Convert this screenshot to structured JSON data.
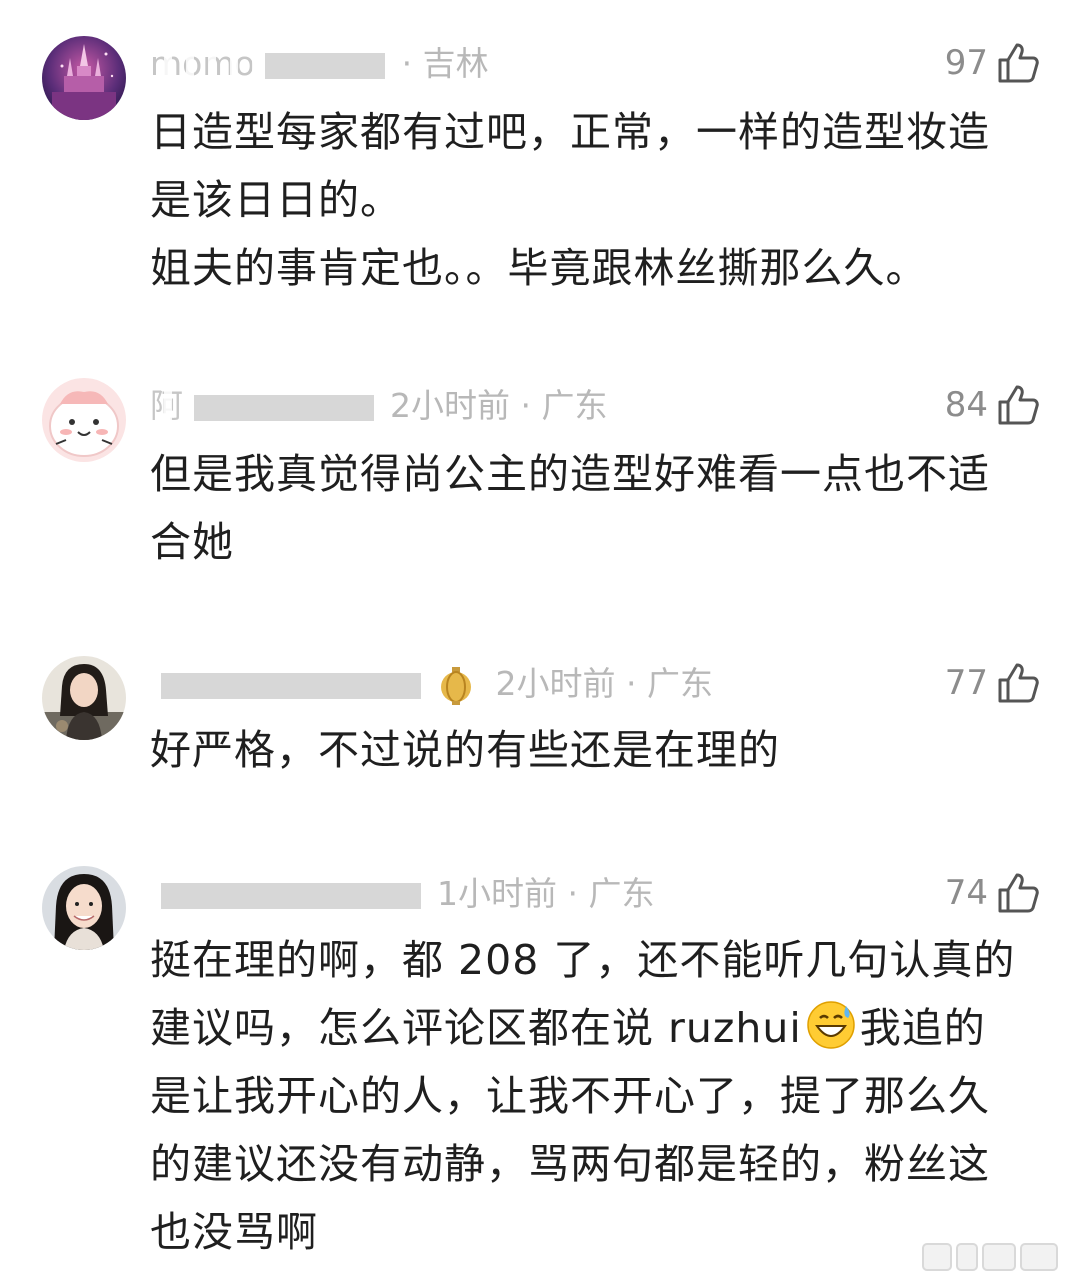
{
  "comments": [
    {
      "nickname": "momo",
      "time": "",
      "location": "· 吉林",
      "likes": "97",
      "avatar": "castle-avatar",
      "lines": [
        "日造型每家都有过吧，正常，一样的造型妆造",
        "是该日日的。",
        "姐夫的事肯定也。。毕竟跟林丝撕那么久。"
      ]
    },
    {
      "nickname": "阿",
      "time": "2小时前",
      "location": "· 广东",
      "likes": "84",
      "avatar": "cartoon-avatar",
      "lines": [
        "但是我真觉得尚公主的造型好难看一点也不适",
        "合她"
      ]
    },
    {
      "nickname": "",
      "time": "2小时前",
      "location": "· 广东",
      "likes": "77",
      "avatar": "woman-avatar",
      "lines": [
        "好严格，不过说的有些还是在理的"
      ]
    },
    {
      "nickname": "",
      "time": "1小时前",
      "location": "· 广东",
      "likes": "74",
      "avatar": "girl-avatar",
      "lines": [
        "挺在理的啊，都 208 了，还不能听几句认真的",
        "建议吗，怎么评论区都在说 ruzhui",
        "我追的",
        "是让我开心的人，让我不开心了，提了那么久",
        "的建议还没有动静，骂两句都是轻的，粉丝这",
        "也没骂啊"
      ]
    }
  ],
  "icons": {
    "like": "thumbs-up-icon",
    "emoji": "grinning-sweat-emoji"
  },
  "colors": {
    "text": "#1f1f1f",
    "meta": "#b8b8b8",
    "like_count": "#8c8c8c"
  }
}
